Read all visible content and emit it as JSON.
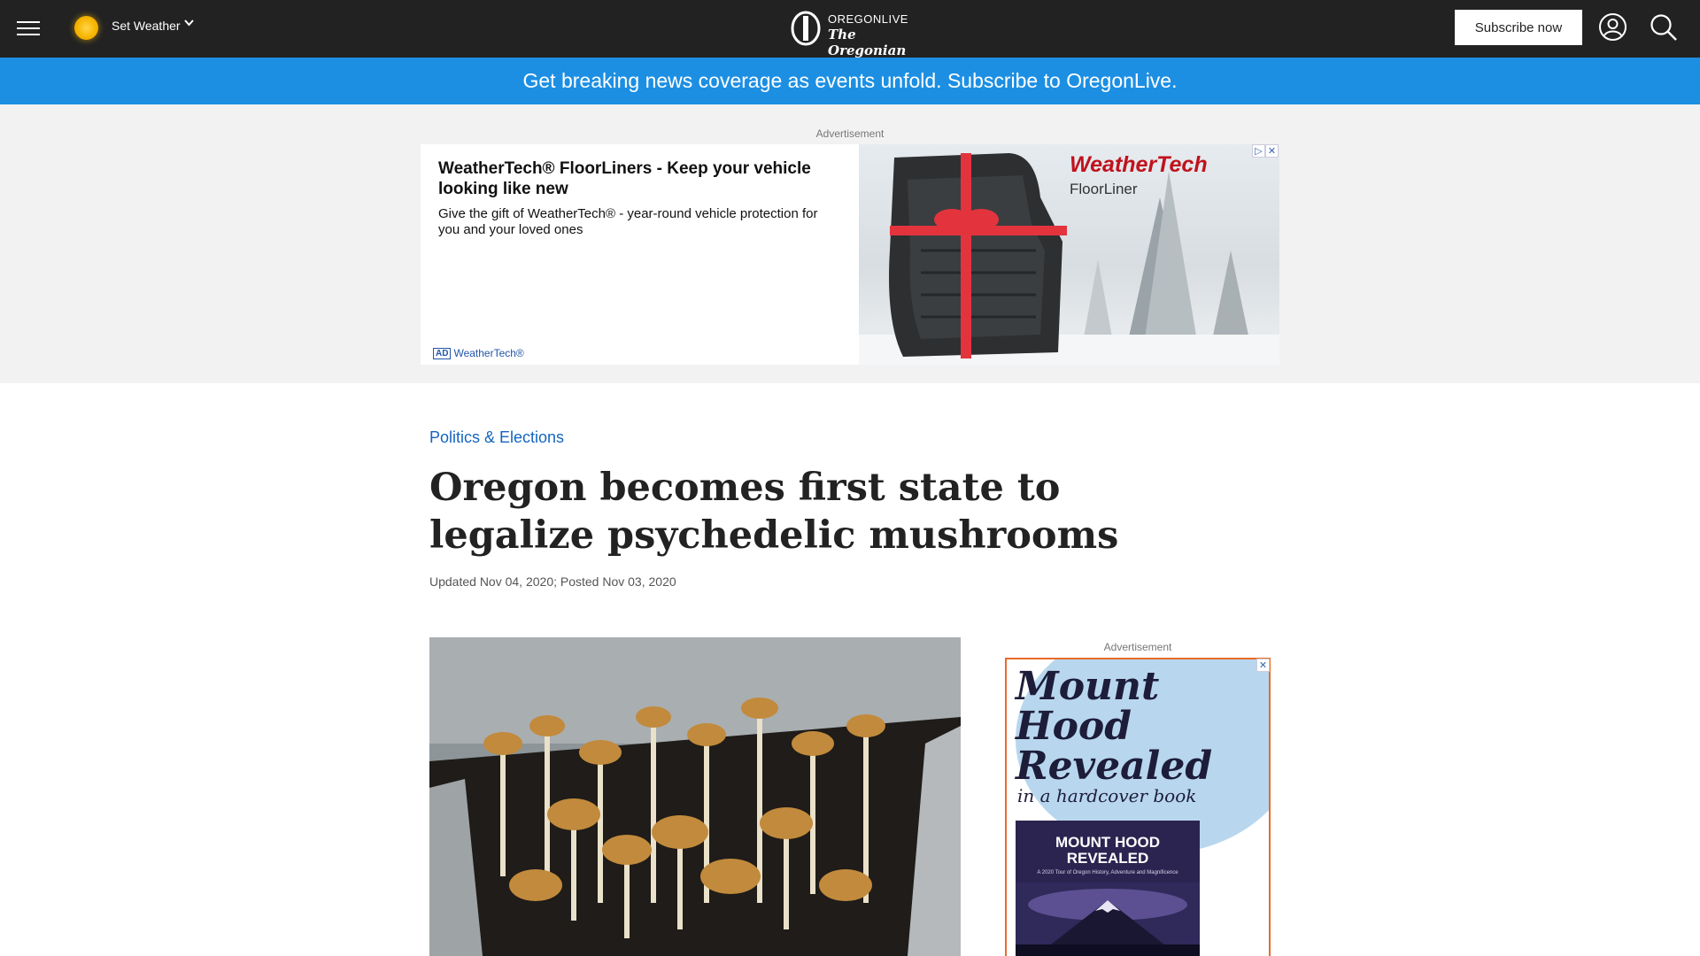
{
  "header": {
    "weather_label": "Set Weather",
    "logo_line1": "OREGONLIVE",
    "logo_line2": "The Oregonian",
    "subscribe_label": "Subscribe now"
  },
  "banner": {
    "text": "Get breaking news coverage as events unfold. Subscribe to OregonLive."
  },
  "ad_top": {
    "label": "Advertisement",
    "headline": "WeatherTech® FloorLiners - Keep your vehicle looking like new",
    "description": "Give the gift of WeatherTech® - year-round vehicle protection for you and your loved ones",
    "badge": "AD",
    "sponsor": "WeatherTech®",
    "brand": "WeatherTech",
    "brand_sub": "FloorLiner"
  },
  "article": {
    "section": "Politics & Elections",
    "title": "Oregon becomes first state to legalize psychedelic mushrooms",
    "dates": "Updated Nov 04, 2020; Posted Nov 03, 2020"
  },
  "ad_side": {
    "label": "Advertisement",
    "title": "Mount Hood Revealed",
    "subtitle": "in a hardcover book",
    "book_title": "MOUNT HOOD REVEALED",
    "book_sub": "A 2020 Tour of Oregon History, Adventure and Magnificence"
  },
  "colors": {
    "header_bg": "#222222",
    "banner_bg": "#1c8fe3",
    "section_link": "#1565c0",
    "ad_border": "#e86b2a"
  }
}
